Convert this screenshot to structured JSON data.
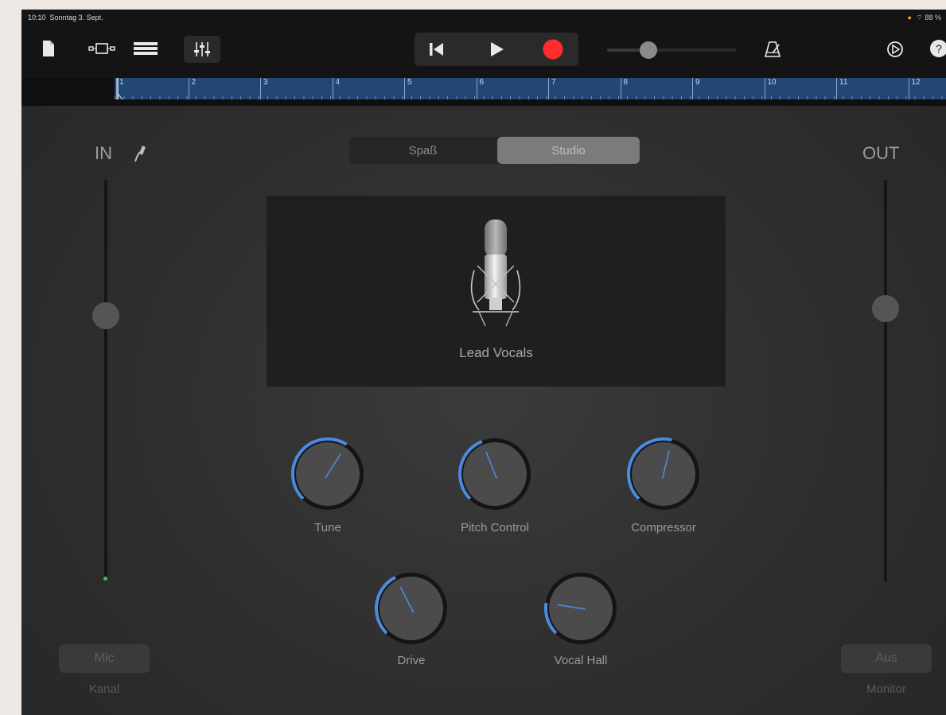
{
  "status": {
    "time": "10:10",
    "date": "Sonntag 3. Sept.",
    "battery": "88 %"
  },
  "toolbar": {
    "my_songs_icon": "document-icon",
    "browser_icon": "browser-icon",
    "tracks_icon": "tracks-view-icon",
    "mixer_icon": "mixer-sliders-icon",
    "rewind_icon": "go-to-start-icon",
    "play_icon": "play-icon",
    "record_icon": "record-icon",
    "metronome_icon": "metronome-icon",
    "settings_icon": "settings-icon",
    "help_icon": "help-icon",
    "record_color": "#ff2d2d",
    "master_volume": 0.32
  },
  "ruler": {
    "bars": [
      "1",
      "2",
      "3",
      "4",
      "5",
      "6",
      "7",
      "8",
      "9",
      "10",
      "11",
      "12"
    ]
  },
  "input": {
    "label": "IN",
    "level": 0.66,
    "button_label": "Mic",
    "caption": "Kanal"
  },
  "output": {
    "label": "OUT",
    "level": 0.68,
    "button_label": "Aus",
    "caption": "Monitor"
  },
  "modes": {
    "options": [
      "Spaß",
      "Studio"
    ],
    "selected": "Studio"
  },
  "preset": {
    "name": "Lead Vocals",
    "icon": "studio-microphone-icon"
  },
  "knobs": [
    {
      "id": "tune",
      "label": "Tune",
      "value": 0.62
    },
    {
      "id": "pitch-control",
      "label": "Pitch Control",
      "value": 0.42
    },
    {
      "id": "compressor",
      "label": "Compressor",
      "value": 0.55
    },
    {
      "id": "drive",
      "label": "Drive",
      "value": 0.4
    },
    {
      "id": "vocal-hall",
      "label": "Vocal Hall",
      "value": 0.2
    }
  ],
  "accent_color": "#4a8be0"
}
